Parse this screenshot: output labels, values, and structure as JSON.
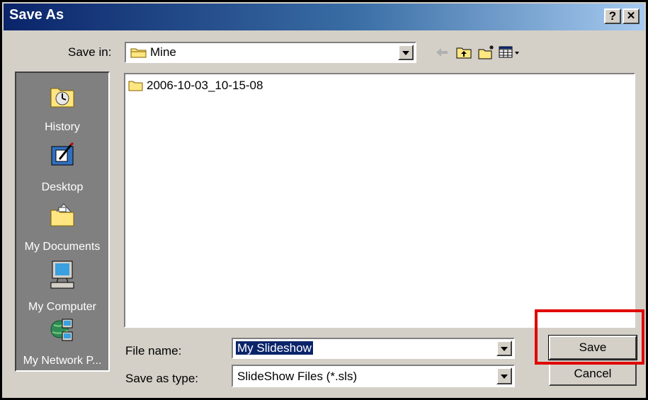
{
  "window": {
    "title": "Save As",
    "help_button": "?",
    "close_button": "✕"
  },
  "save_in": {
    "label": "Save in:",
    "folder": "Mine"
  },
  "toolbar": {
    "icons": [
      "back-arrow-icon",
      "up-folder-icon",
      "new-folder-icon",
      "view-menu-icon"
    ]
  },
  "places": {
    "items": [
      {
        "label": "History",
        "icon": "history-icon"
      },
      {
        "label": "Desktop",
        "icon": "desktop-icon"
      },
      {
        "label": "My Documents",
        "icon": "my-documents-icon"
      },
      {
        "label": "My Computer",
        "icon": "my-computer-icon"
      },
      {
        "label": "My Network P...",
        "icon": "network-places-icon"
      }
    ]
  },
  "files": [
    {
      "name": "2006-10-03_10-15-08",
      "type": "folder"
    }
  ],
  "file_name": {
    "label": "File name:",
    "value": "My Slideshow"
  },
  "save_as_type": {
    "label": "Save as type:",
    "value": "SlideShow Files (*.sls)"
  },
  "buttons": {
    "save": "Save",
    "cancel": "Cancel"
  },
  "colors": {
    "titlebar": "#0a246a",
    "highlight": "#e00000",
    "face": "#d4d0c8"
  }
}
